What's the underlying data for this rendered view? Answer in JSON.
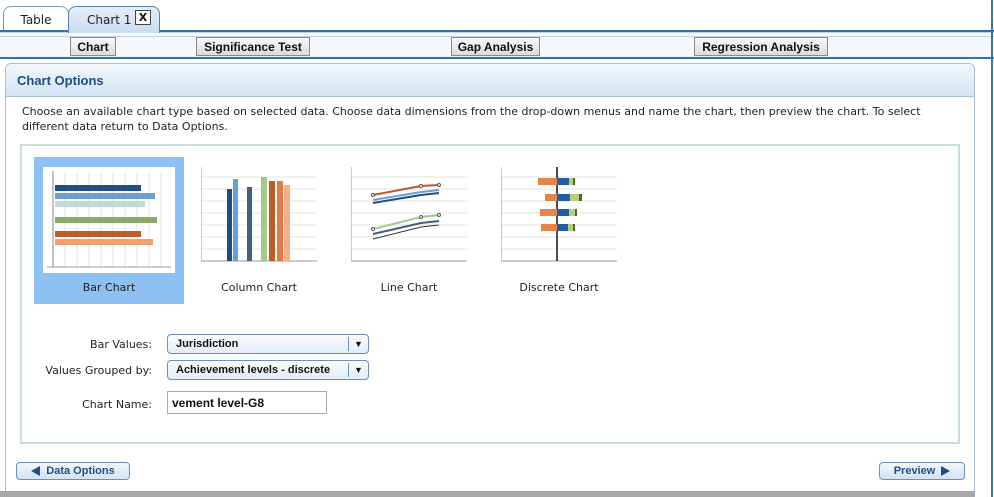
{
  "tabs": [
    {
      "label": "Table"
    },
    {
      "label": "Chart 1",
      "close": "X"
    }
  ],
  "toolbar": {
    "chart": "Chart",
    "significance": "Significance Test",
    "gap": "Gap Analysis",
    "regression": "Regression Analysis"
  },
  "panel": {
    "title": "Chart Options",
    "intro": "Choose an available chart type based on selected data. Choose data dimensions from the drop-down menus and name the chart, then preview the chart. To select different data return to Data Options."
  },
  "chart_types": [
    {
      "label": "Bar Chart",
      "selected": true,
      "icon": "bar-chart-icon"
    },
    {
      "label": "Column Chart",
      "selected": false,
      "icon": "column-chart-icon"
    },
    {
      "label": "Line Chart",
      "selected": false,
      "icon": "line-chart-icon"
    },
    {
      "label": "Discrete Chart",
      "selected": false,
      "icon": "discrete-chart-icon"
    }
  ],
  "form": {
    "bar_values_label": "Bar Values:",
    "bar_values": "Jurisdiction",
    "grouped_label": "Values Grouped by:",
    "grouped": "Achievement levels - discrete",
    "name_label": "Chart Name:",
    "name_value": "vement level-G8"
  },
  "nav": {
    "back": "Data Options",
    "preview": "Preview"
  },
  "colors": {
    "accent": "#3c6fa8",
    "selected": "#8dc1f1",
    "title": "#1f4e85"
  }
}
